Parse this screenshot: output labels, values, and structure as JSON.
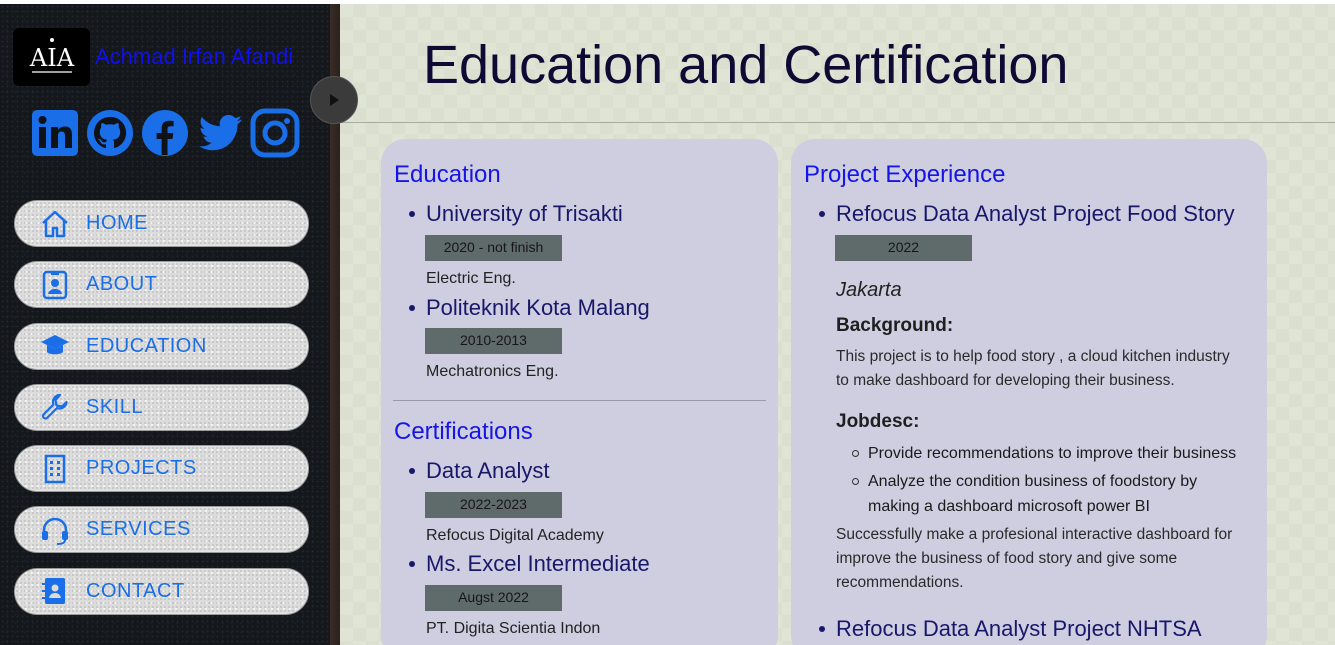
{
  "sidebar": {
    "logo_text": "AIA",
    "site_name": "Achmad Irfan Afandi",
    "socials": [
      {
        "name": "linkedin-icon"
      },
      {
        "name": "github-icon"
      },
      {
        "name": "facebook-icon"
      },
      {
        "name": "twitter-icon"
      },
      {
        "name": "instagram-icon"
      }
    ],
    "nav": [
      {
        "label": "HOME",
        "icon": "home-icon"
      },
      {
        "label": "ABOUT",
        "icon": "person-badge-icon"
      },
      {
        "label": "EDUCATION",
        "icon": "graduation-cap-icon"
      },
      {
        "label": "SKILL",
        "icon": "wrench-icon"
      },
      {
        "label": "PROJECTS",
        "icon": "building-icon"
      },
      {
        "label": "SERVICES",
        "icon": "headset-icon"
      },
      {
        "label": "CONTACT",
        "icon": "contact-book-icon"
      }
    ],
    "accent_color": "#1a6ee8"
  },
  "main": {
    "title": "Education and Certification",
    "education": {
      "heading": "Education",
      "items": [
        {
          "title": "University of Trisakti",
          "years": "2020 - not finish",
          "detail": "Electric Eng."
        },
        {
          "title": "Politeknik Kota Malang",
          "years": "2010-2013",
          "detail": "Mechatronics Eng."
        }
      ]
    },
    "certifications": {
      "heading": "Certifications",
      "items": [
        {
          "title": "Data Analyst",
          "years": "2022-2023",
          "detail": "Refocus Digital Academy"
        },
        {
          "title": "Ms. Excel Intermediate",
          "years": "Augst 2022",
          "detail": "PT. Digita Scientia Indon"
        }
      ]
    },
    "projects": {
      "heading": "Project Experience",
      "items": [
        {
          "title": "Refocus Data Analyst Project Food Story",
          "years": "2022",
          "location": "Jakarta",
          "background_label": "Background:",
          "background_text_1": "This project is to help food story , a cloud kitchen industry",
          "background_text_2": "to make dashboard for developing their business.",
          "jobdesc_label": "Jobdesc:",
          "jobdesc": [
            {
              "line1": "Provide recommendations to improve their business",
              "line2": ""
            },
            {
              "line1": "Analyze the condition business of foodstory by",
              "line2": "making a dashboard microsoft power BI"
            }
          ],
          "result_1": "Successfully make a profesional interactive dashboard for",
          "result_2": "improve the business of food story and give some",
          "result_3": "recommendations."
        },
        {
          "title": "Refocus Data Analyst Project NHTSA"
        }
      ]
    }
  }
}
